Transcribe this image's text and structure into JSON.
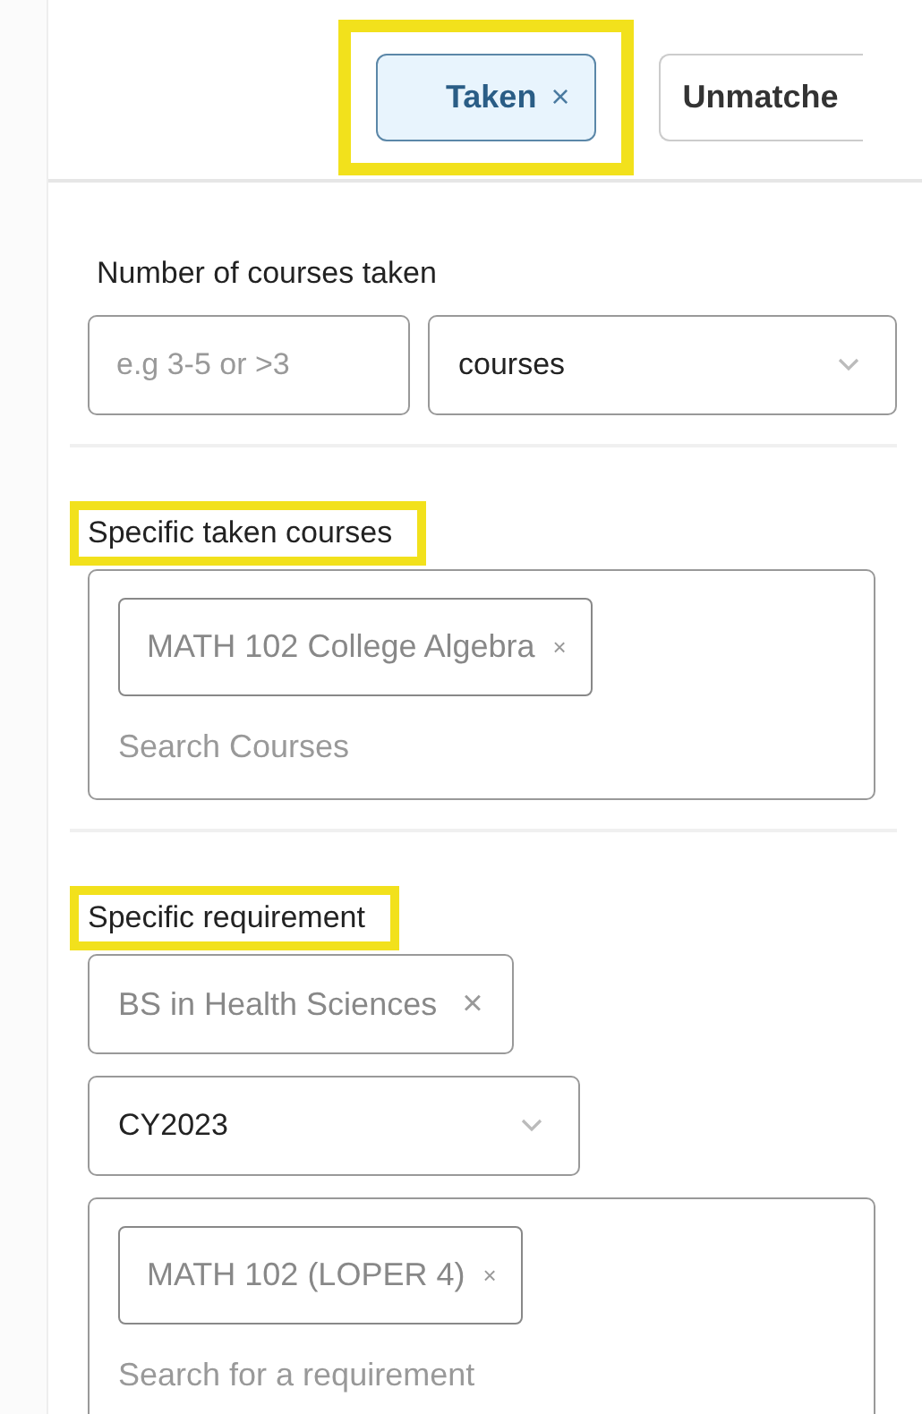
{
  "filter_tabs": [
    {
      "label": "Taken",
      "close": "×",
      "selected": true,
      "highlighted": true
    },
    {
      "label": "Unmatche",
      "selected": false,
      "highlighted": false
    }
  ],
  "sections": [
    {
      "label": "Number of courses taken",
      "highlighted": false,
      "kind": "inline",
      "fields": [
        {
          "kind": "text",
          "placeholder": "e.g 3-5 or >3"
        },
        {
          "kind": "select",
          "value": "courses"
        }
      ]
    },
    {
      "label": "Specific taken courses",
      "highlighted": true,
      "kind": "stacked",
      "fields": [
        {
          "kind": "tagbox",
          "tags": [
            {
              "label": "MATH 102 College Algebra",
              "remove": "×"
            }
          ],
          "placeholder": "Search Courses"
        }
      ]
    },
    {
      "label": "Specific requirement",
      "highlighted": true,
      "kind": "stacked",
      "fields": [
        {
          "kind": "tag",
          "label": "BS in Health Sciences",
          "remove": "×"
        },
        {
          "kind": "select",
          "value": "CY2023"
        },
        {
          "kind": "tagbox",
          "tags": [
            {
              "label": "MATH 102 (LOPER 4)",
              "remove": "×"
            }
          ],
          "placeholder": "Search for a requirement"
        }
      ]
    }
  ]
}
